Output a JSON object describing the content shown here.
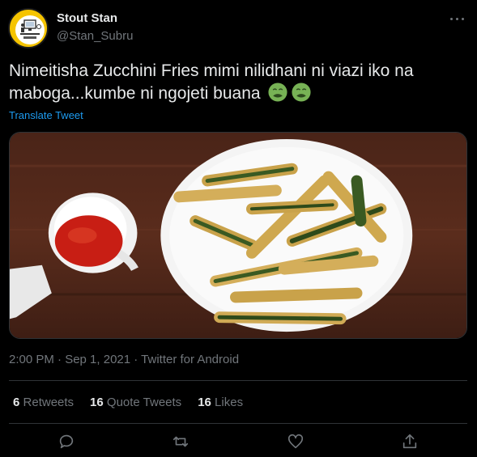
{
  "user": {
    "name": "Stout Stan",
    "handle": "@Stan_Subru"
  },
  "tweet": {
    "text": "Nimeitisha Zucchini Fries mimi nilidhani ni viazi iko na maboga...kumbe ni ngojeti buana",
    "translate_label": "Translate Tweet"
  },
  "meta": {
    "timestamp": "2:00 PM · Sep 1, 2021 · Twitter for Android"
  },
  "stats": {
    "retweets_count": "6",
    "retweets_label": "Retweets",
    "quotes_count": "16",
    "quotes_label": "Quote Tweets",
    "likes_count": "16",
    "likes_label": "Likes"
  },
  "icons": {
    "reply": "reply-icon",
    "retweet": "retweet-icon",
    "like": "heart-icon",
    "share": "share-icon",
    "more": "more-icon",
    "emoji": "nauseated-face-emoji"
  },
  "colors": {
    "accent": "#1d9bf0",
    "bg": "#000000",
    "text": "#e7e9ea",
    "muted": "#71767b"
  }
}
